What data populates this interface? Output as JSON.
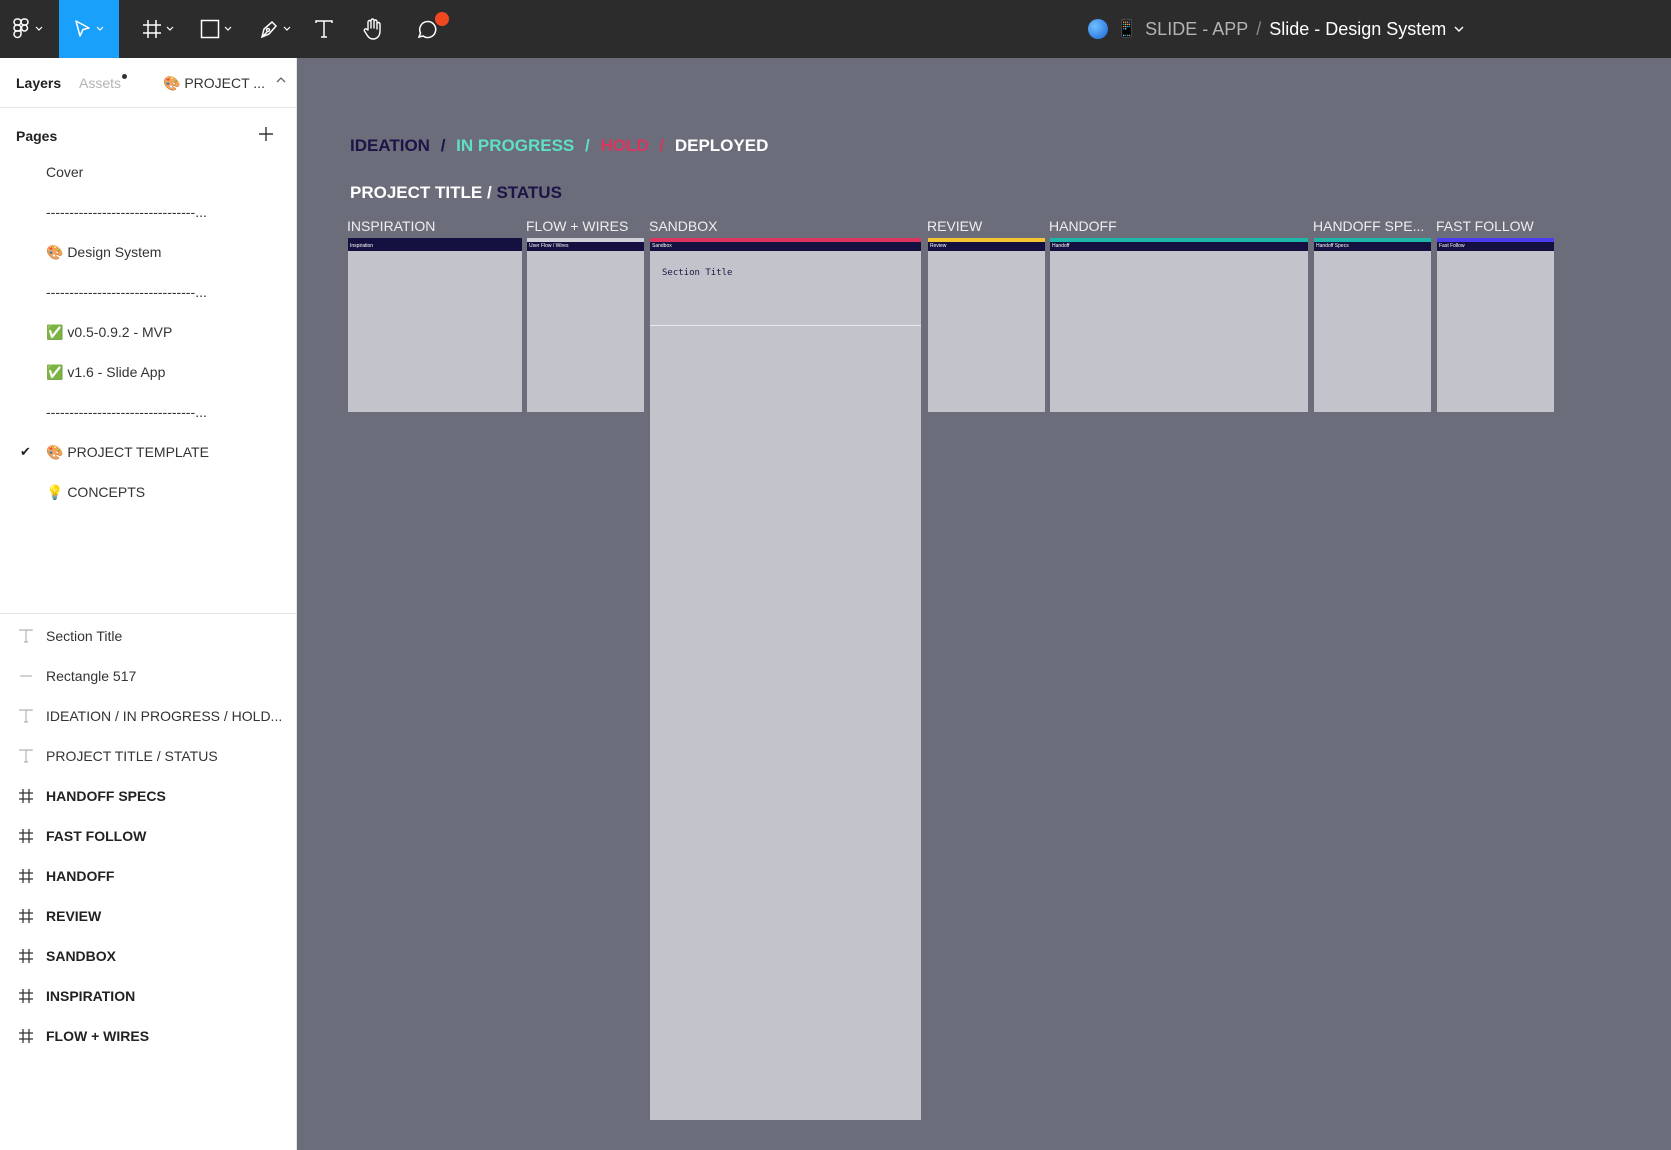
{
  "toolbar": {
    "breadcrumb_project": "SLIDE - APP",
    "breadcrumb_separator": "/",
    "breadcrumb_file": "Slide - Design System",
    "icons": [
      "figma-menu-icon",
      "move-tool-icon",
      "frame-tool-icon",
      "shape-tool-icon",
      "pen-tool-icon",
      "text-tool-icon",
      "hand-tool-icon",
      "comment-icon"
    ]
  },
  "sidebar": {
    "tabs": {
      "layers": "Layers",
      "assets": "Assets",
      "page": "🎨 PROJECT ..."
    },
    "pages_title": "Pages",
    "pages": [
      {
        "label": "Cover"
      },
      {
        "label": "--------------------------------..."
      },
      {
        "label": "🎨 Design System"
      },
      {
        "label": "--------------------------------..."
      },
      {
        "label": "✅ v0.5-0.9.2 - MVP"
      },
      {
        "label": "✅ v1.6 - Slide App"
      },
      {
        "label": "--------------------------------..."
      },
      {
        "label": "🎨 PROJECT TEMPLATE",
        "selected": true
      },
      {
        "label": "💡 CONCEPTS"
      }
    ],
    "check_mark": "✔",
    "layers": [
      {
        "label": "Section Title",
        "type": "text"
      },
      {
        "label": "Rectangle 517",
        "type": "line"
      },
      {
        "label": "IDEATION / IN PROGRESS / HOLD...",
        "type": "text"
      },
      {
        "label": "PROJECT TITLE / STATUS",
        "type": "text"
      },
      {
        "label": "HANDOFF SPECS",
        "type": "frame"
      },
      {
        "label": "FAST FOLLOW",
        "type": "frame"
      },
      {
        "label": "HANDOFF",
        "type": "frame"
      },
      {
        "label": "REVIEW",
        "type": "frame"
      },
      {
        "label": "SANDBOX",
        "type": "frame"
      },
      {
        "label": "INSPIRATION",
        "type": "frame"
      },
      {
        "label": "FLOW + WIRES",
        "type": "frame"
      }
    ]
  },
  "canvas": {
    "legend": {
      "ideation": "IDEATION",
      "sep1": "/",
      "in_progress": "IN PROGRESS",
      "sep2": "/",
      "hold": "HOLD",
      "sep3": "/",
      "deployed": "DEPLOYED"
    },
    "title": "PROJECT TITLE",
    "title_sep": "/",
    "status": "STATUS",
    "frames": [
      {
        "label": "INSPIRATION",
        "head": "Inspiration",
        "stripe": "#14103f"
      },
      {
        "label": "FLOW + WIRES",
        "head": "User Flow / Wires",
        "stripe": "#c3c3cc"
      },
      {
        "label": "SANDBOX",
        "head": "Sandbox",
        "stripe": "#d9355f",
        "section_title": "Section Title"
      },
      {
        "label": "REVIEW",
        "head": "Review",
        "stripe": "#f5c531"
      },
      {
        "label": "HANDOFF",
        "head": "Handoff",
        "stripe": "#1fb5a8"
      },
      {
        "label": "HANDOFF SPE...",
        "head": "Handoff Specs",
        "stripe": "#1fb5a8"
      },
      {
        "label": "FAST FOLLOW",
        "head": "Fast Follow",
        "stripe": "#4b3cf0"
      }
    ]
  },
  "colors": {
    "toolbar_bg": "#2c2c2c",
    "active_tool": "#18a0fb",
    "canvas_bg": "#6b6d7b",
    "ideation": "#1a1447",
    "in_progress": "#5fe0c6",
    "hold": "#d9355f",
    "deployed": "#ffffff"
  }
}
